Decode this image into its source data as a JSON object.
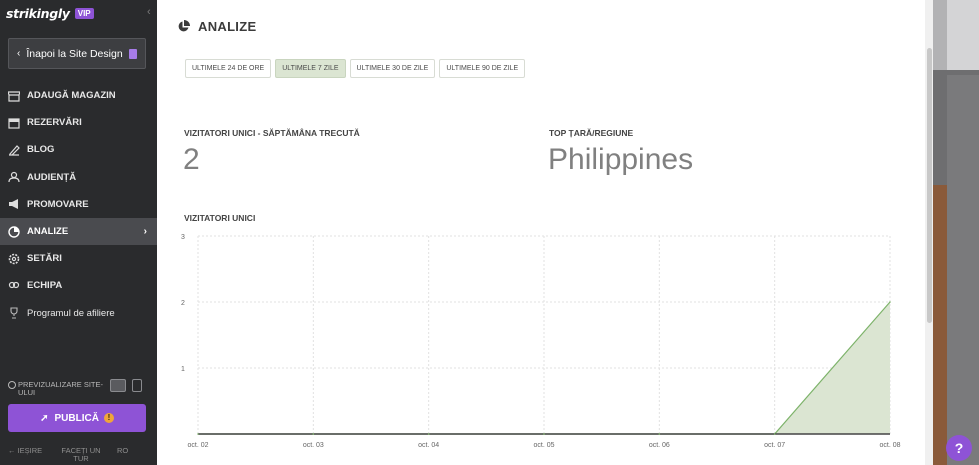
{
  "sidebar": {
    "logo": "strikingly",
    "vip_badge": "VIP",
    "back_button": "Înapoi la Site Design",
    "nav": [
      {
        "label": "ADAUGĂ MAGAZIN",
        "icon": "store-icon"
      },
      {
        "label": "REZERVĂRI",
        "icon": "calendar-icon"
      },
      {
        "label": "BLOG",
        "icon": "pen-icon"
      },
      {
        "label": "AUDIENȚĂ",
        "icon": "users-icon"
      },
      {
        "label": "PROMOVARE",
        "icon": "megaphone-icon"
      },
      {
        "label": "ANALIZE",
        "icon": "pie-chart-icon",
        "active": true
      },
      {
        "label": "SETĂRI",
        "icon": "gear-icon"
      },
      {
        "label": "ECHIPA",
        "icon": "team-icon"
      },
      {
        "label": "Programul de afiliere",
        "icon": "trophy-icon"
      }
    ],
    "preview_label": "PREVIZUALIZARE SITE-ULUI",
    "publish_label": "PUBLICĂ",
    "footer": {
      "exit": "IEȘIRE",
      "tour": "FACEȚI UN TUR",
      "lang": "RO"
    }
  },
  "main": {
    "title": "ANALIZE",
    "tabs": [
      {
        "label": "ULTIMELE 24 DE ORE"
      },
      {
        "label": "ULTIMELE 7 ZILE",
        "active": true
      },
      {
        "label": "ULTIMELE 30 DE ZILE"
      },
      {
        "label": "ULTIMELE 90 DE ZILE"
      }
    ],
    "stats": {
      "visitors_label": "VIZITATORI UNICI - SĂPTĂMÂNA TRECUTĂ",
      "visitors_value": "2",
      "top_country_label": "TOP ȚARĂ/REGIUNE",
      "top_country_value": "Philippines"
    },
    "chart_title": "VIZITATORI UNICI"
  },
  "help_label": "?",
  "colors": {
    "accent": "#8e53d6",
    "area_fill": "#dbe5d2",
    "area_line": "#7db36a"
  },
  "chart_data": {
    "type": "area",
    "title": "VIZITATORI UNICI",
    "categories": [
      "oct. 02",
      "oct. 03",
      "oct. 04",
      "oct. 05",
      "oct. 06",
      "oct. 07",
      "oct. 08"
    ],
    "series": [
      {
        "values": [
          0,
          0,
          0,
          0,
          0,
          0,
          2
        ]
      }
    ],
    "yticks": [
      "1",
      "2",
      "3"
    ],
    "ylim": [
      0,
      3
    ],
    "grid": true,
    "legend": "none"
  }
}
